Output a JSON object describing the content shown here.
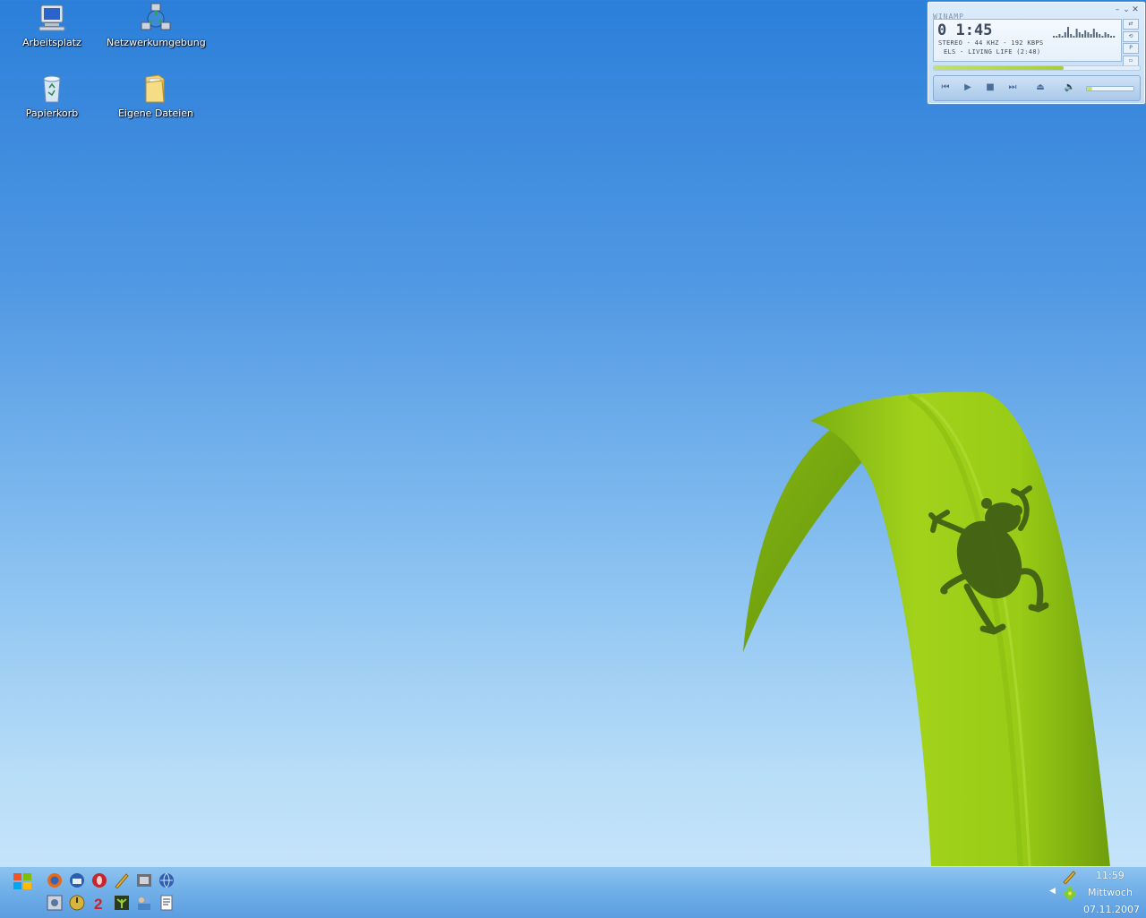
{
  "desktop": {
    "icons": [
      {
        "label": "Arbeitsplatz",
        "icon": "computer-icon"
      },
      {
        "label": "Netzwerkumgebung",
        "icon": "network-icon"
      },
      {
        "label": "Papierkorb",
        "icon": "recycle-bin-icon"
      },
      {
        "label": "Eigene Dateien",
        "icon": "folder-icon"
      }
    ]
  },
  "winamp": {
    "title": "WINAMP",
    "time": "0 1:45",
    "info": "STEREO - 44 KHZ - 192 KBPS",
    "track": "ELS - LIVING LIFE (2:48)",
    "seek_progress": 0.63,
    "volume": 0.12,
    "controls": [
      "previous-icon",
      "play-icon",
      "stop-icon",
      "next-icon",
      "eject-icon",
      "volume-icon"
    ]
  },
  "taskbar": {
    "clock_time": "11:59",
    "clock_day": "Mittwoch",
    "clock_date": "07.11.2007",
    "quicklaunch_row1": [
      "firefox-icon",
      "thunderbird-icon",
      "opera-icon",
      "pen-tool-icon",
      "film-icon",
      "globe-icon"
    ],
    "quicklaunch_row2": [
      "settings-icon",
      "power-icon",
      "number-two-icon",
      "plant-icon",
      "people-icon",
      "document-icon"
    ],
    "tray_icons": [
      "pencil-tray-icon",
      "flower-tray-icon"
    ]
  },
  "colors": {
    "desktop_top": "#2b7fd9",
    "desktop_bottom": "#cbe7fb",
    "leaf": "#9ed018",
    "frog": "#3e5b12",
    "taskbar": "#74b2ea"
  }
}
